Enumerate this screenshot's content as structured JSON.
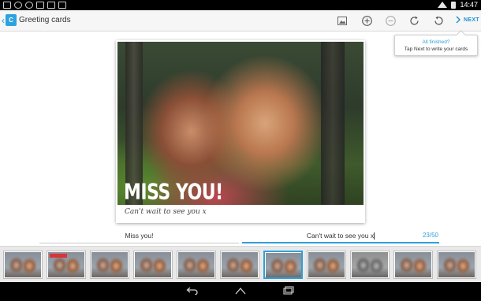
{
  "status_bar": {
    "time": "14:47",
    "icons": [
      "gallery-icon",
      "sync-icon",
      "cloud-icon",
      "phone-icon",
      "sd-card-icon",
      "play-store-icon",
      "wifi-icon",
      "battery-icon"
    ]
  },
  "action_bar": {
    "app_title": "Greeting cards",
    "app_icon_text": "C",
    "toolbar_icons": [
      "image-icon",
      "zoom-in-icon",
      "zoom-out-icon",
      "rotate-right-icon",
      "rotate-left-icon"
    ],
    "next_label": "NEXT"
  },
  "tooltip": {
    "title": "All finished?",
    "body": "Tap Next to write your cards"
  },
  "card": {
    "headline": "MISS YOU!",
    "caption": "Can't wait to see you x"
  },
  "fields": {
    "headline_value": "Miss you!",
    "caption_value": "Can't wait to see you x",
    "char_counter": "23/50"
  },
  "thumbnails": {
    "count": 11,
    "selected_index": 6
  },
  "colors": {
    "accent": "#2ea0d8",
    "action_bar_bg": "#f6f6f6",
    "nav_bar_bg": "#000000"
  }
}
